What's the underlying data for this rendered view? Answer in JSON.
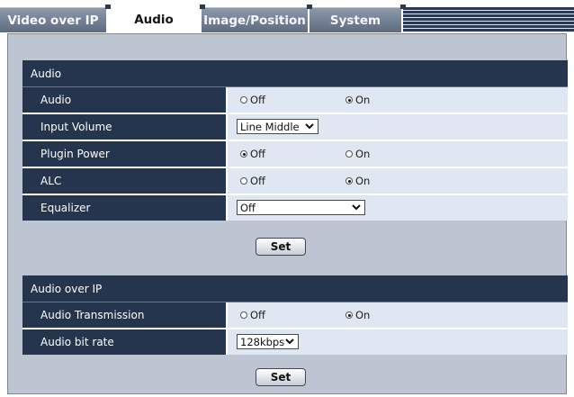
{
  "tabs": [
    {
      "label": "Video over IP"
    },
    {
      "label": "Audio"
    },
    {
      "label": "Image/Position"
    },
    {
      "label": "System"
    }
  ],
  "audio_section": {
    "title": "Audio",
    "rows": [
      {
        "label": "Audio",
        "type": "radio",
        "options": [
          "Off",
          "On"
        ],
        "selected": "On"
      },
      {
        "label": "Input Volume",
        "type": "select",
        "value": "Line Middle"
      },
      {
        "label": "Plugin Power",
        "type": "radio",
        "options": [
          "Off",
          "On"
        ],
        "selected": "Off"
      },
      {
        "label": "ALC",
        "type": "radio",
        "options": [
          "Off",
          "On"
        ],
        "selected": "On"
      },
      {
        "label": "Equalizer",
        "type": "select",
        "value": "Off"
      }
    ],
    "set_label": "Set"
  },
  "aoip_section": {
    "title": "Audio over IP",
    "rows": [
      {
        "label": "Audio Transmission",
        "type": "radio",
        "options": [
          "Off",
          "On"
        ],
        "selected": "On"
      },
      {
        "label": "Audio bit rate",
        "type": "select",
        "value": "128kbps"
      }
    ],
    "set_label": "Set"
  },
  "colors": {
    "header_navy": "#25354e",
    "value_bg": "#dfe7f2",
    "panel_bg": "#bcc5d1"
  }
}
